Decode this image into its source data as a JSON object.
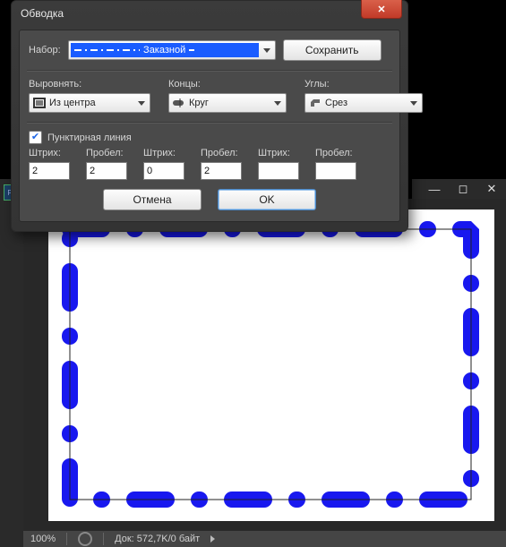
{
  "dialog": {
    "title": "Обводка",
    "set_label": "Набор:",
    "set_caption": "Заказной",
    "save_label": "Сохранить",
    "align_label": "Выровнять:",
    "align_value": "Из центра",
    "caps_label": "Концы:",
    "caps_value": "Круг",
    "corners_label": "Углы:",
    "corners_value": "Срез",
    "dashed_label": "Пунктирная линия",
    "dash_label": "Штрих:",
    "gap_label": "Пробел:",
    "d1": "2",
    "g1": "2",
    "d2": "0",
    "g2": "2",
    "d3": "",
    "g3": "",
    "cancel_label": "Отмена",
    "ok_label": "OK"
  },
  "status": {
    "zoom": "100%",
    "doc": "Док: 572,7K/0 байт"
  }
}
